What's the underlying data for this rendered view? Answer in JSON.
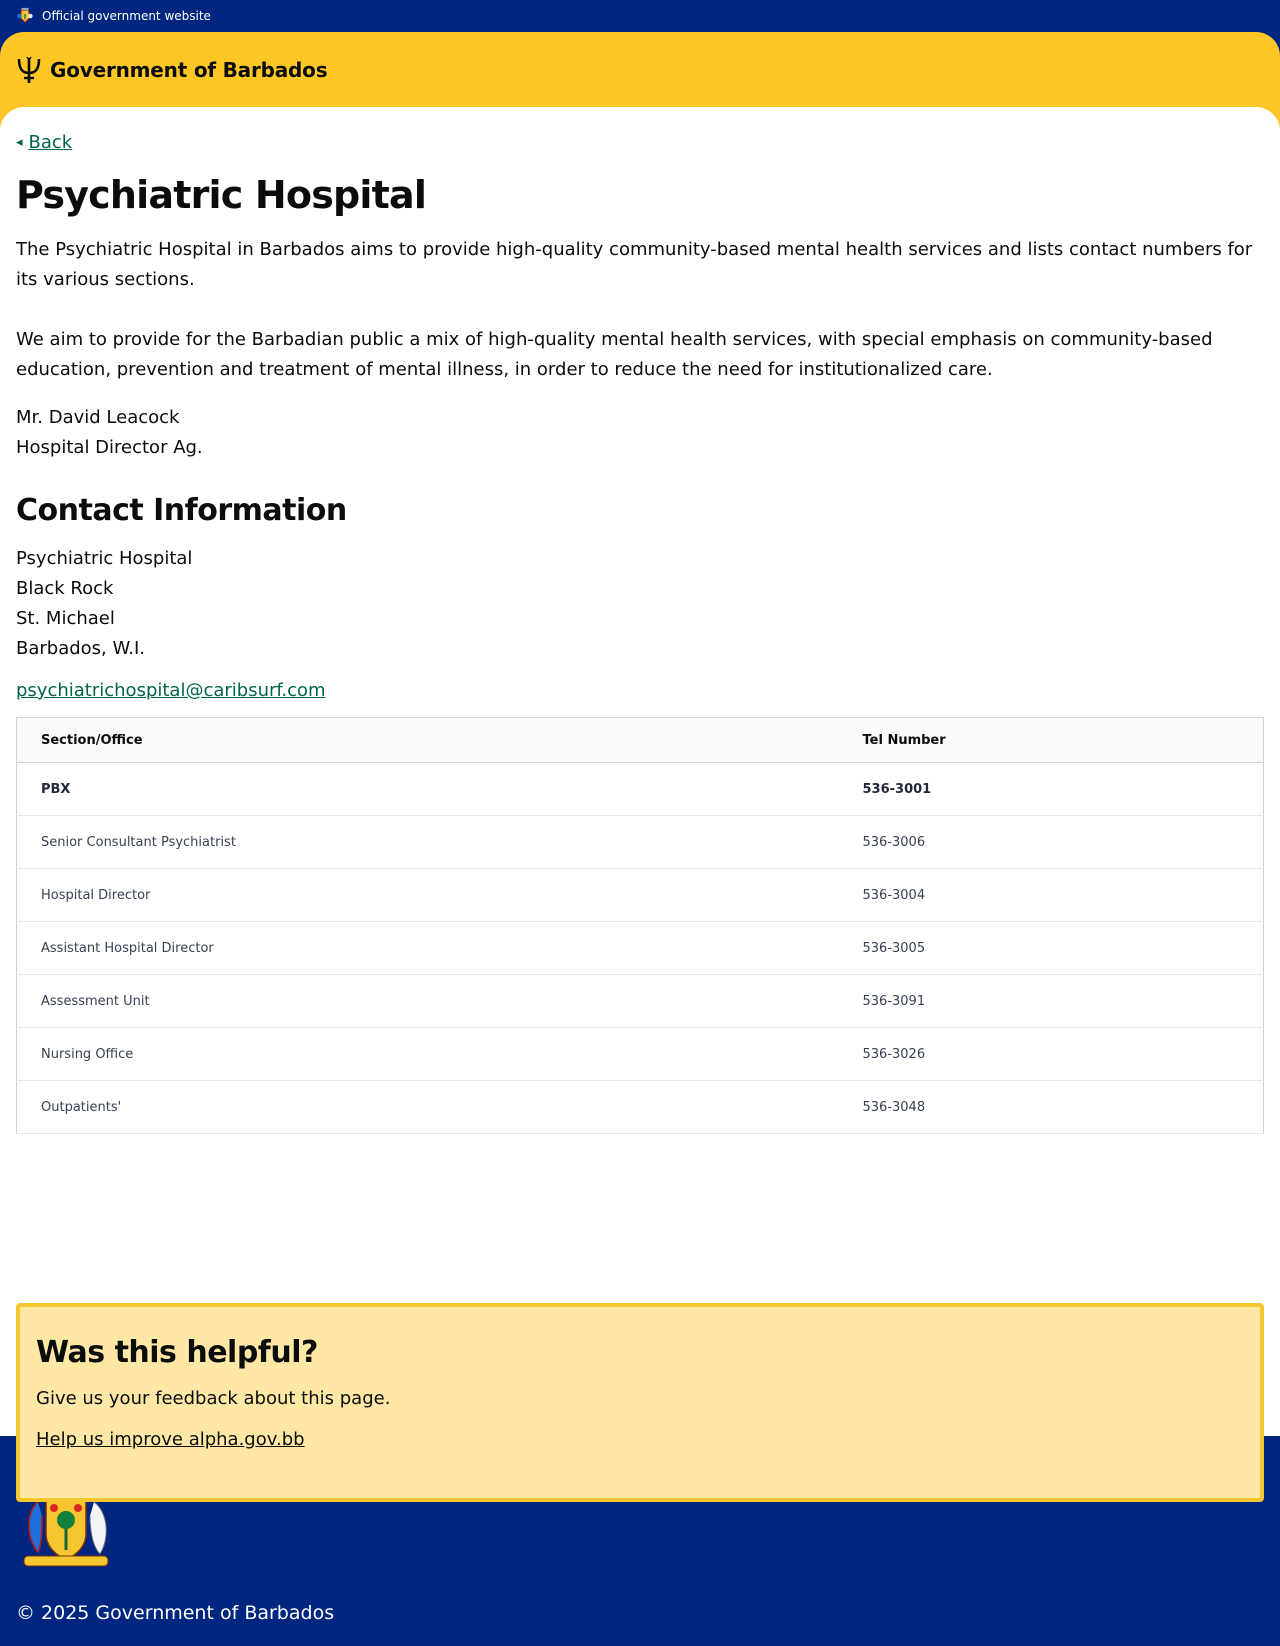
{
  "topbar": {
    "label": "Official government website",
    "icon": "coat-of-arms-icon"
  },
  "header": {
    "brand": "Government of Barbados",
    "icon": "trident-icon",
    "color": "#ffc726"
  },
  "nav": {
    "back_label": "Back"
  },
  "page": {
    "title": "Psychiatric Hospital",
    "intro": "The Psychiatric Hospital in Barbados aims to provide high-quality community-based mental health services and lists contact numbers for its various sections.",
    "mission": "We aim to provide for the Barbadian public a mix of high-quality mental health services, with special emphasis on community-based education, prevention and treatment of mental illness, in order to reduce the need for institutionalized care.",
    "director_name": "Mr. David Leacock",
    "director_title": "Hospital Director Ag."
  },
  "contact": {
    "heading": "Contact Information",
    "address": [
      "Psychiatric Hospital",
      "Black Rock",
      "St. Michael",
      "Barbados, W.I."
    ],
    "email": "psychiatrichospital@caribsurf.com"
  },
  "table": {
    "headers": [
      "Section/Office",
      "Tel Number"
    ],
    "rows": [
      [
        "PBX",
        "536-3001"
      ],
      [
        "Senior Consultant Psychiatrist",
        "536-3006"
      ],
      [
        "Hospital Director",
        "536-3004"
      ],
      [
        "Assistant Hospital Director",
        "536-3005"
      ],
      [
        "Assessment Unit",
        "536-3091"
      ],
      [
        "Nursing Office",
        "536-3026"
      ],
      [
        "Outpatients'",
        "536-3048"
      ]
    ]
  },
  "feedback": {
    "heading": "Was this helpful?",
    "text": "Give us your feedback about this page.",
    "link": "Help us improve alpha.gov.bb"
  },
  "footer": {
    "copyright": "© 2025 Government of Barbados",
    "icon": "coat-of-arms-icon"
  },
  "colors": {
    "navy": "#00267f",
    "yellow": "#ffc726",
    "link_green": "#00654a",
    "feedback_bg": "#ffe8a6"
  }
}
